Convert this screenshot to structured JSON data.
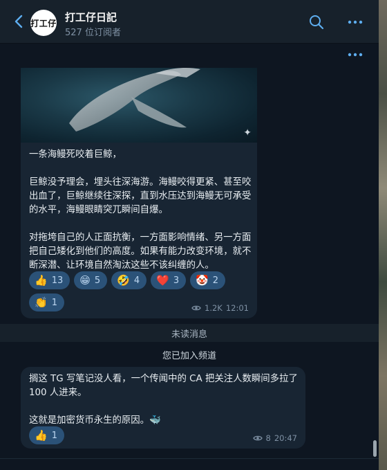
{
  "header": {
    "channel_name": "打工仔日記",
    "avatar_text": "打工仔",
    "subscribers": "527 位订阅者"
  },
  "colors": {
    "accent": "#5eaef0",
    "reaction_bg": "#2b5278",
    "bubble_bg": "#182533",
    "chat_bg": "#0e1621"
  },
  "post1": {
    "text": "一条海鳗死咬着巨鲸，\n\n巨鲸没予理会，埋头往深海游。海鳗咬得更紧、甚至咬出血了，巨鲸继续往深探，直到水压达到海鳗无可承受的水平，海鳗眼睛突兀瞬间自爆。\n\n对拖垮自己的人正面抗衡，一方面影响情绪、另一方面把自己矮化到他们的高度。如果有能力改变环境，就不断深潜、让环境自然淘汰这些不该纠缠的人。",
    "sparkle": "✦",
    "reactions": [
      {
        "emoji": "👍",
        "count": "13"
      },
      {
        "emoji": "😁",
        "count": "5"
      },
      {
        "emoji": "🤣",
        "count": "4"
      },
      {
        "emoji": "❤️",
        "count": "3"
      },
      {
        "emoji": "🤡",
        "count": "2"
      },
      {
        "emoji": "👏",
        "count": "1"
      }
    ],
    "views": "1.2K",
    "time": "12:01"
  },
  "unread_label": "未读消息",
  "service_message": "您已加入频道",
  "post2": {
    "text": "搁这 TG 写笔记没人看，一个传闻中的 CA 把关注人数瞬间多拉了 100 人进来。\n\n这就是加密货币永生的原因。🐳",
    "reactions": [
      {
        "emoji": "👍",
        "count": "1"
      }
    ],
    "views": "8",
    "time": "20:47"
  }
}
